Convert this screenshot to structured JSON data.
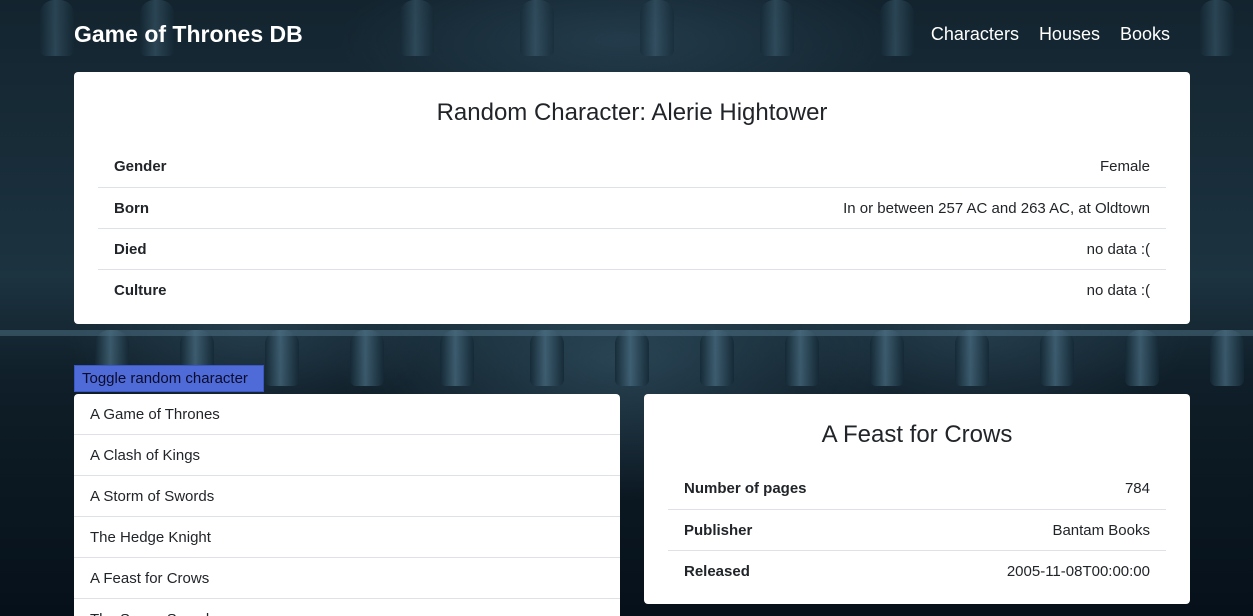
{
  "navbar": {
    "brand": "Game of Thrones DB",
    "links": [
      "Characters",
      "Houses",
      "Books"
    ]
  },
  "random_character": {
    "title": "Random Character: Alerie Hightower",
    "details": [
      {
        "term": "Gender",
        "value": "Female"
      },
      {
        "term": "Born",
        "value": "In or between 257 AC and 263 AC, at Oldtown"
      },
      {
        "term": "Died",
        "value": "no data :("
      },
      {
        "term": "Culture",
        "value": "no data :("
      }
    ]
  },
  "toggle_button": "Toggle random character",
  "book_list": [
    "A Game of Thrones",
    "A Clash of Kings",
    "A Storm of Swords",
    "The Hedge Knight",
    "A Feast for Crows",
    "The Sworn Sword"
  ],
  "book_details": {
    "title": "A Feast for Crows",
    "details": [
      {
        "term": "Number of pages",
        "value": "784"
      },
      {
        "term": "Publisher",
        "value": "Bantam Books"
      },
      {
        "term": "Released",
        "value": "2005-11-08T00:00:00"
      }
    ]
  }
}
